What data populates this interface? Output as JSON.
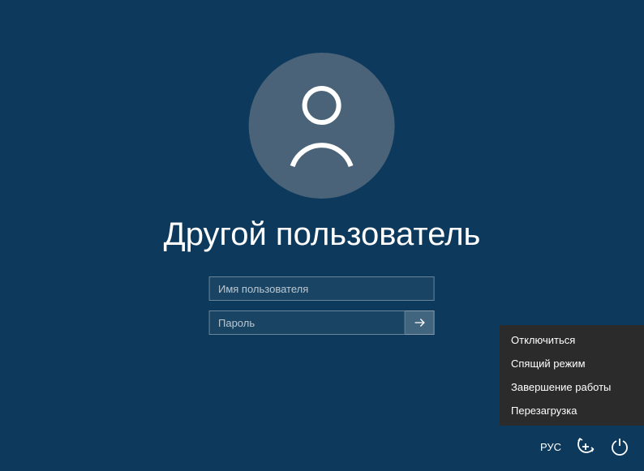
{
  "user": {
    "title": "Другой пользователь"
  },
  "inputs": {
    "username_placeholder": "Имя пользователя",
    "password_placeholder": "Пароль"
  },
  "power_menu": {
    "items": [
      "Отключиться",
      "Спящий режим",
      "Завершение работы",
      "Перезагрузка"
    ]
  },
  "bottom": {
    "language": "РУС"
  }
}
